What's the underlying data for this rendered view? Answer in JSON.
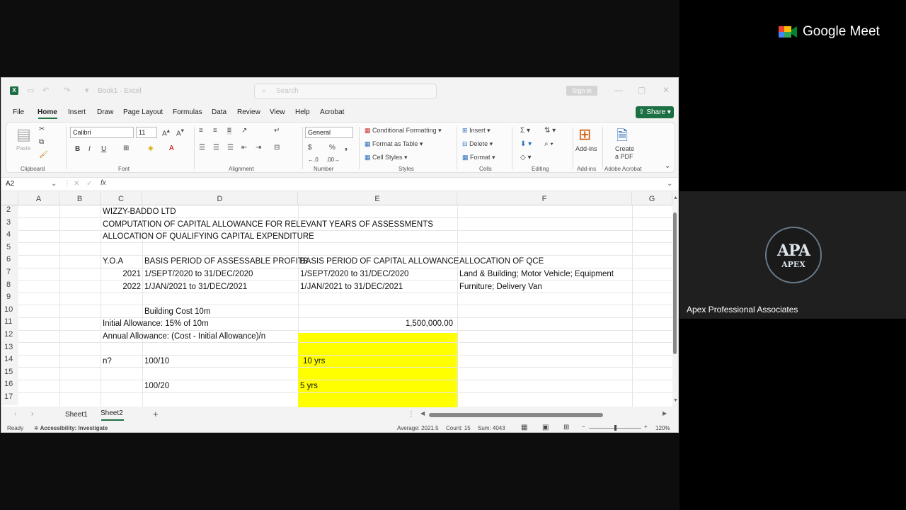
{
  "meet": {
    "brand": "Google Meet",
    "participant_name": "Apex Professional Associates",
    "avatar_text_big": "APA",
    "avatar_text_small": "APEX"
  },
  "excel": {
    "title_doc": "Book1 · Excel",
    "search_placeholder": "Search",
    "signin_label": "Sign in",
    "menu": [
      "File",
      "Home",
      "Insert",
      "Draw",
      "Page Layout",
      "Formulas",
      "Data",
      "Review",
      "View",
      "Help",
      "Acrobat"
    ],
    "share_label": "Share",
    "ribbon": {
      "paste": "Paste",
      "font_name": "Calibri",
      "font_size": "11",
      "number_format": "General",
      "conditional_formatting": "Conditional Formatting",
      "format_as_table": "Format as Table",
      "cell_styles": "Cell Styles",
      "insert": "Insert",
      "delete": "Delete",
      "format": "Format",
      "add_ins": "Add-ins",
      "create_pdf_1": "Create",
      "create_pdf_2": "a PDF",
      "groups": [
        "Clipboard",
        "Font",
        "Alignment",
        "Number",
        "Styles",
        "Cells",
        "Editing",
        "Add-ins",
        "Adobe Acrobat"
      ]
    },
    "name_box": "A2",
    "columns": [
      "A",
      "B",
      "C",
      "D",
      "E",
      "F",
      "G"
    ],
    "rows": [
      "2",
      "3",
      "4",
      "5",
      "6",
      "7",
      "8",
      "9",
      "10",
      "11",
      "12",
      "13",
      "14",
      "15",
      "16",
      "17"
    ],
    "cells": {
      "c2": "WIZZY-BADDO LTD",
      "c3": "COMPUTATION OF CAPITAL ALLOWANCE FOR RELEVANT YEARS OF ASSESSMENTS",
      "c4": "ALLOCATION OF QUALIFYING CAPITAL EXPENDITURE",
      "c6": "Y.O.A",
      "d6": "BASIS PERIOD OF ASSESSABLE PROFITS",
      "e6": "BASIS PERIOD OF CAPITAL ALLOWANCE",
      "f6": "ALLOCATION OF QCE",
      "c7": "2021",
      "d7": "1/SEPT/2020 to 31/DEC/2020",
      "e7": "1/SEPT/2020 to 31/DEC/2020",
      "f7": "Land & Building; Motor Vehicle; Equipment",
      "c8": "2022",
      "d8": "1/JAN/2021 to 31/DEC/2021",
      "e8": "1/JAN/2021 to 31/DEC/2021",
      "f8": "Furniture; Delivery Van",
      "d10": "Building Cost 10m",
      "c11": "Initial Allowance: 15% of 10m",
      "e11": "1,500,000.00",
      "c12": "Annual Allowance: (Cost - Initial Allowance)/n",
      "c14": "n?",
      "d14": "100/10",
      "e14": "10 yrs",
      "d16": "100/20",
      "e16": "5 yrs"
    },
    "sheets": [
      "Sheet1",
      "Sheet2"
    ],
    "active_sheet": "Sheet2",
    "status": {
      "ready": "Ready",
      "accessibility": "Accessibility: Investigate",
      "average": "Average: 2021.5",
      "count": "Count: 15",
      "sum": "Sum: 4043",
      "zoom": "120%"
    }
  }
}
